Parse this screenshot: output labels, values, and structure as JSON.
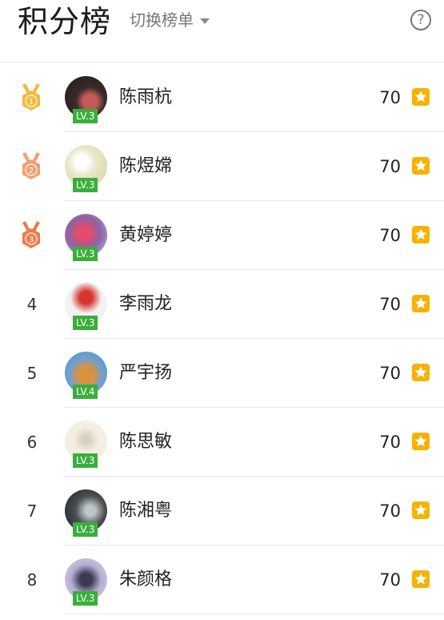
{
  "header": {
    "title": "积分榜",
    "switch_label": "切换榜单",
    "help_icon": "?"
  },
  "leaderboard": [
    {
      "rank": "1",
      "medal": "gold",
      "name": "陈雨杭",
      "level": "LV.3",
      "score": "70"
    },
    {
      "rank": "2",
      "medal": "silver",
      "name": "陈煜嫦",
      "level": "LV.3",
      "score": "70"
    },
    {
      "rank": "3",
      "medal": "bronze",
      "name": "黄婷婷",
      "level": "LV.3",
      "score": "70"
    },
    {
      "rank": "4",
      "medal": null,
      "name": "李雨龙",
      "level": "LV.3",
      "score": "70"
    },
    {
      "rank": "5",
      "medal": null,
      "name": "严宇扬",
      "level": "LV.4",
      "score": "70"
    },
    {
      "rank": "6",
      "medal": null,
      "name": "陈思敏",
      "level": "LV.3",
      "score": "70"
    },
    {
      "rank": "7",
      "medal": null,
      "name": "陈湘粤",
      "level": "LV.3",
      "score": "70"
    },
    {
      "rank": "8",
      "medal": null,
      "name": "朱颜格",
      "level": "LV.3",
      "score": "70"
    }
  ],
  "colors": {
    "level_badge": "#3aae3c",
    "star_badge": "#f5b300",
    "medal_gold": "#f6b93b",
    "medal_silver": "#f0a070",
    "medal_bronze": "#ee7b4a"
  },
  "icons": {
    "medal": "medal-icon",
    "score": "star-icon",
    "help": "question-circle-icon",
    "switch": "caret-down-icon"
  }
}
